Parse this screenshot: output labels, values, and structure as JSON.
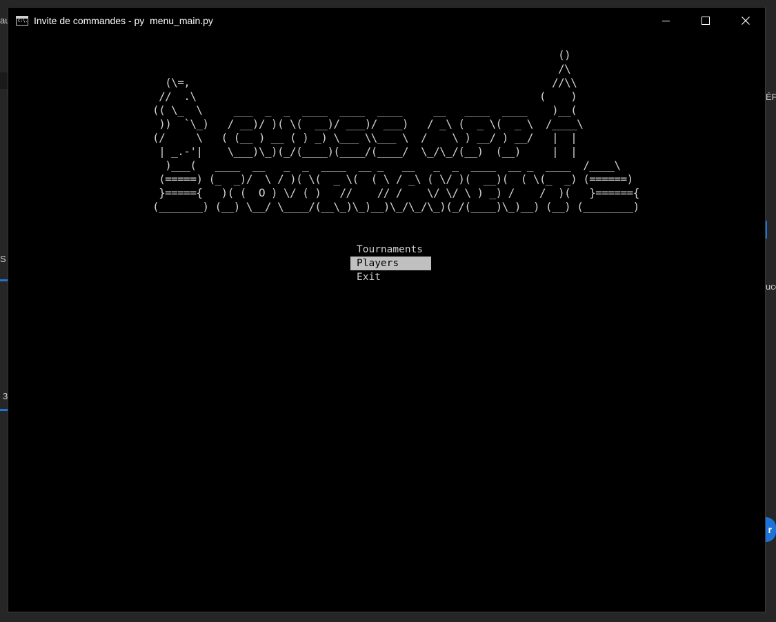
{
  "window": {
    "title": "Invite de commandes - py  menu_main.py",
    "icon": "cmd-icon",
    "icon_text": "C:\\.",
    "controls": [
      "minimize-icon",
      "maximize-icon",
      "close-icon"
    ]
  },
  "background_fragments": {
    "top_left": "au",
    "right_top": "ÉF",
    "left_mid": "S I",
    "right_mid": "uce",
    "left_low": "3",
    "button_right": "r"
  },
  "banner": {
    "ascii_art": "                                                                  ()\n                                                                  /\\\n   (\\=,                                                          //\\\\\n  //  .\\                                                       (    )\n (( \\_  \\     ___  _  _  ____  ____  ____     __   ____  ____    )__(\n  ))  `\\_)   / __)/ )( \\(  __)/ ___)/ ___)   / _\\ (  _ \\(  _ \\  /____\\\n (/     \\   ( (__ ) __ ( ) _) \\___ \\\\___ \\  /    \\ ) __/ ) __/   |  |\n  | _.-'|    \\___)\\_)(_/(____)(____/(____/  \\_/\\_/(__)  (__)     |  |\n   )___(   ____  __   _  _  ____  __ _   __   _  _  ____  __ _  ____  /____\\\n  (=====) (_  _)/  \\ / )( \\(  _ \\(  ( \\ / _\\ ( \\/ )(  __)(  ( \\(_  _) (======)\n  }====={   )( (  O ) \\/ ( )   //    // /    \\/ \\/ \\ ) _) /    /  )(   }======{\n (_______) (__) \\__/ \\____/(__\\_)\\_)__)\\_/\\_/\\_)(_/(____)\\_)__) (__) (________)"
  },
  "menu": {
    "items": [
      "Tournaments",
      "Players",
      "Exit"
    ],
    "selected_index": 1
  },
  "colors": {
    "console_bg": "#000000",
    "console_fg": "#cfcfcf",
    "selection_bg": "#c0c0c0",
    "selection_fg": "#000000"
  }
}
